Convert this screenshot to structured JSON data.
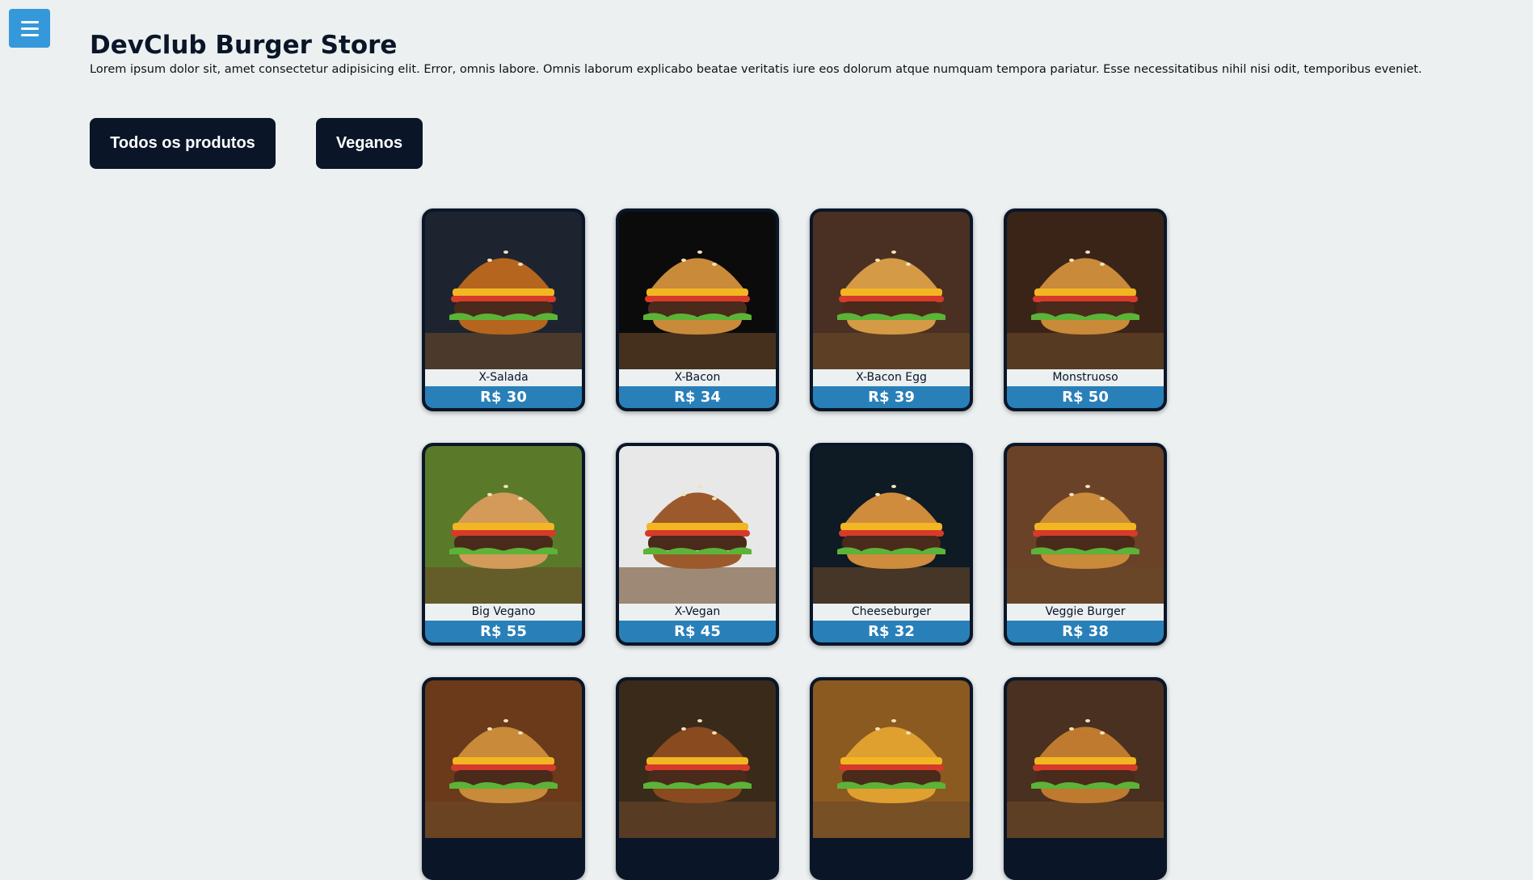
{
  "header": {
    "title": "DevClub Burger Store",
    "description": "Lorem ipsum dolor sit, amet consectetur adipisicing elit. Error, omnis labore. Omnis laborum explicabo beatae veritatis iure eos dolorum atque numquam tempora pariatur. Esse necessitatibus nihil nisi odit, temporibus eveniet."
  },
  "menu": {
    "icon": "hamburger-menu-icon",
    "color": "#3498db"
  },
  "filters": [
    {
      "label": "Todos os produtos"
    },
    {
      "label": "Veganos"
    }
  ],
  "products": [
    {
      "name": "X-Salada",
      "price": "R$ 30",
      "bg": "#1d2430",
      "bun": "#b5651d"
    },
    {
      "name": "X-Bacon",
      "price": "R$ 34",
      "bg": "#0b0b0b",
      "bun": "#c98a3a"
    },
    {
      "name": "X-Bacon Egg",
      "price": "R$ 39",
      "bg": "#4a3022",
      "bun": "#d59a46"
    },
    {
      "name": "Monstruoso",
      "price": "R$ 50",
      "bg": "#3a2418",
      "bun": "#c98a3a"
    },
    {
      "name": "Big Vegano",
      "price": "R$ 55",
      "bg": "#5a7a2a",
      "bun": "#d49a5a"
    },
    {
      "name": "X-Vegan",
      "price": "R$ 45",
      "bg": "#e8e8e8",
      "bun": "#9c5a2c"
    },
    {
      "name": "Cheeseburger",
      "price": "R$ 32",
      "bg": "#0e1a24",
      "bun": "#cf8c3c"
    },
    {
      "name": "Veggie Burger",
      "price": "R$ 38",
      "bg": "#6a4228",
      "bun": "#c98a3a"
    },
    {
      "name": "",
      "price": "",
      "bg": "#6a3a1a",
      "bun": "#c98a3a"
    },
    {
      "name": "",
      "price": "",
      "bg": "#3a2a1a",
      "bun": "#8a4a20"
    },
    {
      "name": "",
      "price": "",
      "bg": "#8a5a20",
      "bun": "#e0a030"
    },
    {
      "name": "",
      "price": "",
      "bg": "#4a3020",
      "bun": "#c07a30"
    }
  ],
  "colors": {
    "primary": "#0a1628",
    "accent": "#2980b9",
    "background": "#ecf0f1"
  }
}
